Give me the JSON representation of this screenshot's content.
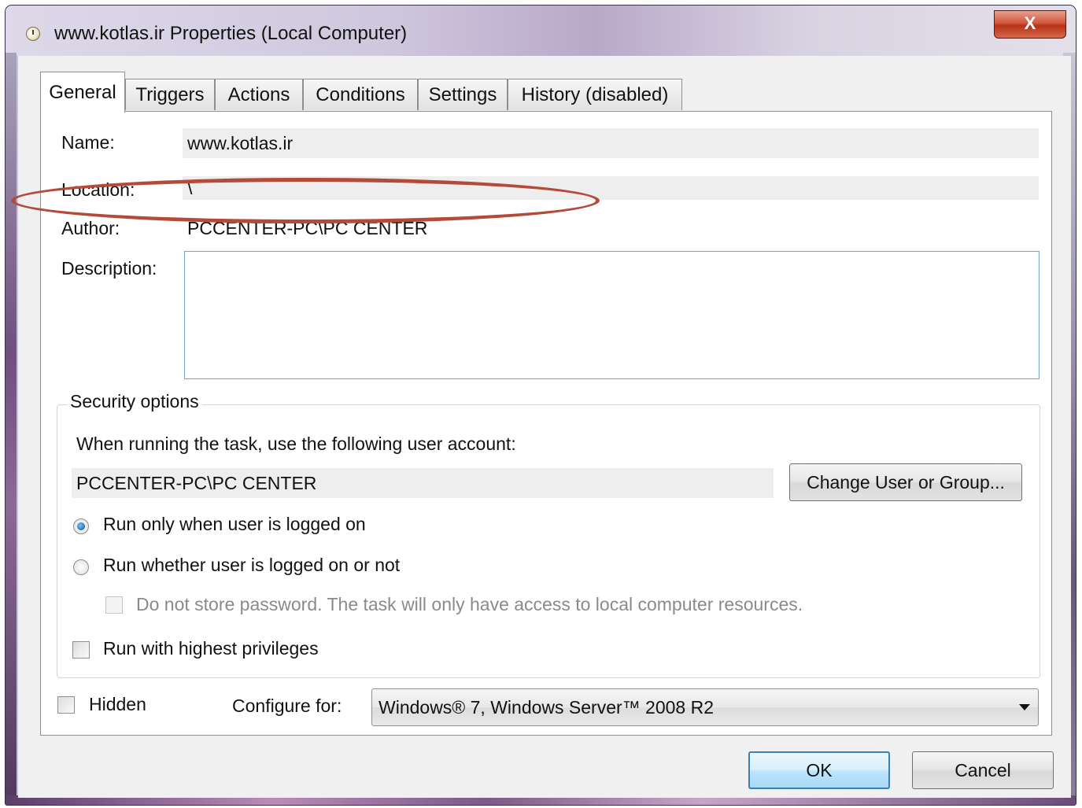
{
  "window": {
    "title": "www.kotlas.ir Properties (Local Computer)",
    "close_label": "X"
  },
  "tabs": [
    {
      "label": "General",
      "active": true
    },
    {
      "label": "Triggers"
    },
    {
      "label": "Actions"
    },
    {
      "label": "Conditions"
    },
    {
      "label": "Settings"
    },
    {
      "label": "History (disabled)"
    }
  ],
  "general": {
    "name_label": "Name:",
    "name_value": "www.kotlas.ir",
    "location_label": "Location:",
    "location_value": "\\",
    "author_label": "Author:",
    "author_value": "PCCENTER-PC\\PC CENTER",
    "description_label": "Description:",
    "description_value": ""
  },
  "security": {
    "legend": "Security options",
    "account_prompt": "When running the task, use the following user account:",
    "account_value": "PCCENTER-PC\\PC CENTER",
    "change_button": "Change User or Group...",
    "radio_logged_on": "Run only when user is logged on",
    "radio_whether": "Run whether user is logged on or not",
    "no_store_password": "Do not store password.  The task will only have access to local computer resources.",
    "highest_privileges": "Run with highest privileges"
  },
  "bottom": {
    "hidden_label": "Hidden",
    "configure_label": "Configure for:",
    "configure_value": "Windows® 7, Windows Server™ 2008 R2"
  },
  "buttons": {
    "ok": "OK",
    "cancel": "Cancel"
  },
  "colors": {
    "annotation_oval": "#b34a3a",
    "title_close": "#c8452a"
  }
}
